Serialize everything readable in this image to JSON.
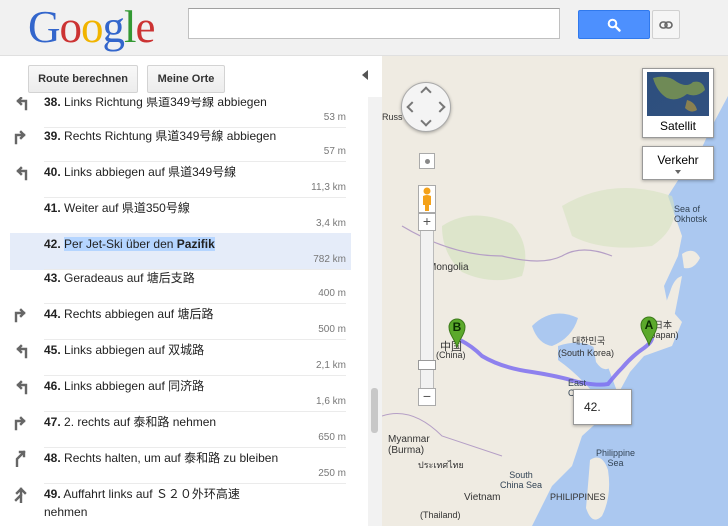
{
  "header": {
    "logo": [
      "G",
      "o",
      "o",
      "g",
      "l",
      "e"
    ],
    "search_value": "",
    "search_icon": "magnifier-icon",
    "link_icon": "chain-link-icon"
  },
  "toolbar": {
    "route_label": "Route berechnen",
    "places_label": "Meine Orte"
  },
  "directions": [
    {
      "num": "38.",
      "text": "Links Richtung 県道349号線 abbiegen",
      "dist": "53 m",
      "turn": "left"
    },
    {
      "num": "39.",
      "text": "Rechts Richtung 県道349号線 abbiegen",
      "dist": "57 m",
      "turn": "right"
    },
    {
      "num": "40.",
      "text": "Links abbiegen auf 県道349号線",
      "dist": "11,3 km",
      "turn": "left"
    },
    {
      "num": "41.",
      "text": "Weiter auf 県道350号線",
      "dist": "3,4 km",
      "turn": "none"
    },
    {
      "num": "42.",
      "text": "Per Jet-Ski über den ",
      "bold": "Pazifik",
      "dist": "782 km",
      "turn": "none"
    },
    {
      "num": "43.",
      "text": "Geradeaus auf 塘后支路",
      "dist": "400 m",
      "turn": "none"
    },
    {
      "num": "44.",
      "text": "Rechts abbiegen auf 塘后路",
      "dist": "500 m",
      "turn": "right"
    },
    {
      "num": "45.",
      "text": "Links abbiegen auf 双城路",
      "dist": "2,1 km",
      "turn": "left"
    },
    {
      "num": "46.",
      "text": "Links abbiegen auf 同济路",
      "dist": "1,6 km",
      "turn": "left"
    },
    {
      "num": "47.",
      "text": "2. rechts auf 泰和路 nehmen",
      "dist": "650 m",
      "turn": "right"
    },
    {
      "num": "48.",
      "text": "Rechts halten, um auf 泰和路 zu bleiben",
      "dist": "250 m",
      "turn": "slight-right"
    },
    {
      "num": "49.",
      "text": "Auffahrt links auf Ｓ２０外环高速",
      "text2": "nehmen",
      "dist": "",
      "turn": "ramp-left"
    }
  ],
  "map": {
    "satellite_label": "Satellit",
    "traffic_label": "Verkehr",
    "callout": "42.",
    "marker_a": "A",
    "marker_b": "B",
    "labels": {
      "sea_okhotsk": "Sea of\nOkhotsk",
      "russia": "Russ",
      "mongolia": "Mongolia",
      "china_native": "中国",
      "china": "(China)",
      "korea_native": "대한민국",
      "south_korea": "(South Korea)",
      "japan_native": "日本",
      "japan": "(Japan)",
      "east_china": "East\nChin",
      "myanmar": "Myanmar\n(Burma)",
      "south_china_sea": "South\nChina Sea",
      "philippine_sea": "Philippine\nSea",
      "vietnam": "Vietnam",
      "philippines": "PHILIPPINES",
      "thailand_native": "ประเทศไทย",
      "thailand": "(Thailand)"
    }
  },
  "colors": {
    "route": "#7c6ff0",
    "marker": "#5ba92b",
    "highlight_row": "#e5ecf9",
    "selection": "#b5d5ff",
    "search_button": "#4d90fe"
  }
}
